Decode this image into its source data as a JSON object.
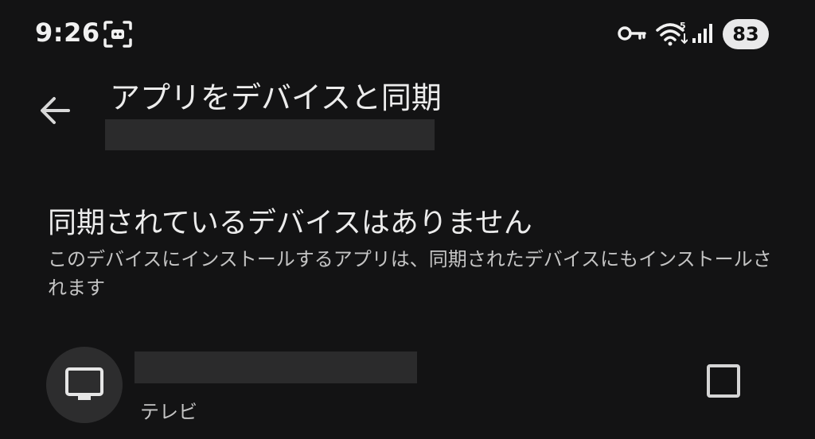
{
  "status_bar": {
    "time": "9:26",
    "battery": "83",
    "icons": [
      "screenshot-icon",
      "vpn-key-icon",
      "wifi-icon",
      "signal-icon"
    ]
  },
  "header": {
    "title": "アプリをデバイスと同期",
    "back_icon": "arrow-back-icon"
  },
  "empty_state": {
    "heading": "同期されているデバイスはありません",
    "description": "このデバイスにインストールするアプリは、同期されたデバイスにもインストールされます"
  },
  "devices": [
    {
      "type_label": "テレビ",
      "icon": "tv-icon",
      "checked": false
    }
  ],
  "colors": {
    "background": "#131314",
    "text_primary": "#ececec",
    "text_secondary": "#c4c4c4",
    "redaction": "#2b2b2c",
    "battery_badge": "#e9e9ea"
  }
}
